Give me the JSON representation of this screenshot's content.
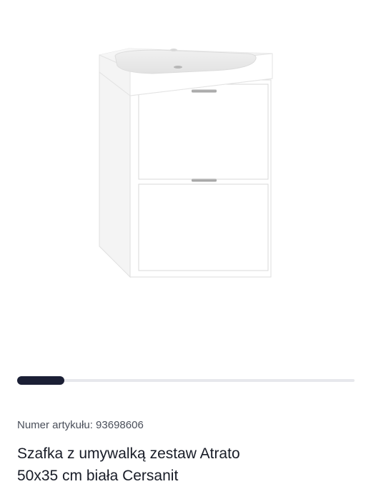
{
  "product": {
    "image_alt": "Szafka z umywalką zestaw Atrato 50x35 cm biała Cersanit",
    "article_number_label": "Numer artykułu:",
    "article_number": "93698606",
    "title_line_1": "Szafka z umywalką zestaw Atrato",
    "title_line_2": "50x35 cm biała Cersanit"
  },
  "gallery": {
    "progress_fraction": 0.14,
    "progress_color": "#1b1f35",
    "track_color": "#e7e8ec"
  }
}
